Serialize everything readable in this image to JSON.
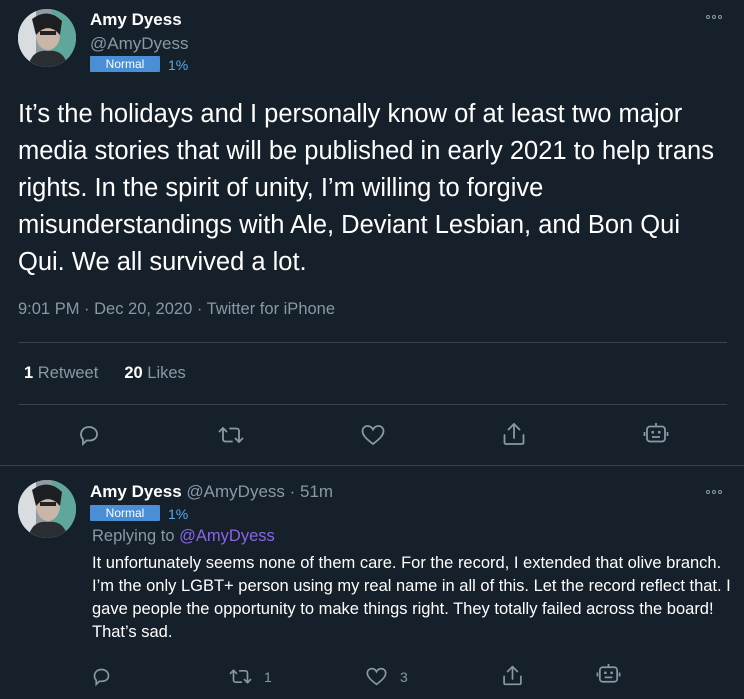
{
  "main_tweet": {
    "name": "Amy Dyess",
    "handle": "@AmyDyess",
    "badge": "Normal",
    "badge_pct": "1%",
    "text": "It’s the holidays and I personally know of at least two major media stories that will be published in early 2021 to help trans rights. In the spirit of unity, I’m willing to forgive misunderstandings with Ale, Deviant Lesbian, and Bon Qui Qui. We all survived a lot.",
    "meta": "9:01 PM · Dec 20, 2020 · Twitter for iPhone",
    "retweet_count": "1",
    "retweet_label": "Retweet",
    "like_count": "20",
    "like_label": "Likes"
  },
  "reply_tweet": {
    "name": "Amy Dyess",
    "handle_time": "@AmyDyess · 51m",
    "badge": "Normal",
    "badge_pct": "1%",
    "replying_prefix": "Replying to",
    "replying_to": "@AmyDyess",
    "text": "It unfortunately seems none of them care. For the record, I extended that olive branch. I’m the only LGBT+ person using my real name in all of this.  Let the record reflect that. I gave people the opportunity to make things right. They totally failed across the board! That’s sad.",
    "retweet_count": "1",
    "like_count": "3"
  },
  "colors": {
    "background": "#15202b",
    "secondary_text": "#8899a6",
    "badge": "#4a8ed6",
    "mention": "#8b63e8"
  },
  "icons": [
    "reply-icon",
    "retweet-icon",
    "like-icon",
    "share-icon",
    "bot-icon",
    "more-icon"
  ]
}
